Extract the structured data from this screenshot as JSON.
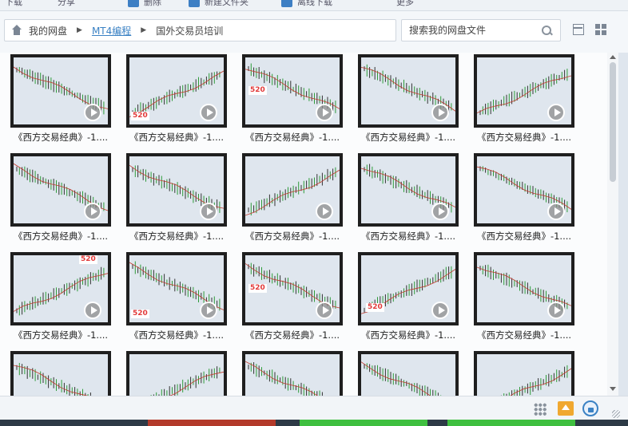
{
  "toolbar": {
    "items": [
      {
        "label": "下载",
        "icon": "download-icon"
      },
      {
        "label": "分享",
        "icon": "share-icon"
      },
      {
        "label": "删除",
        "icon": "delete-icon"
      },
      {
        "label": "新建文件夹",
        "icon": "new-folder-icon"
      },
      {
        "label": "离线下载",
        "icon": "offline-download-icon"
      },
      {
        "label": "更多",
        "icon": "more-icon"
      }
    ]
  },
  "breadcrumb": {
    "home": "我的网盘",
    "folder": "MT4编程",
    "current": "国外交易员培训"
  },
  "search": {
    "placeholder": "搜索我的网盘文件"
  },
  "files": {
    "label": "《西方交易经典》-1....",
    "items": [
      {
        "logo": false
      },
      {
        "logo": true
      },
      {
        "logo": true
      },
      {
        "logo": false
      },
      {
        "logo": false
      },
      {
        "logo": false
      },
      {
        "logo": false
      },
      {
        "logo": false
      },
      {
        "logo": false
      },
      {
        "logo": false
      },
      {
        "logo": true
      },
      {
        "logo": true
      },
      {
        "logo": true
      },
      {
        "logo": true
      },
      {
        "logo": false
      },
      {
        "logo": false
      },
      {
        "logo": false
      },
      {
        "logo": false
      },
      {
        "logo": false
      },
      {
        "logo": false
      }
    ]
  },
  "logo_text": "520",
  "colors": {
    "accent": "#3b82c4",
    "candle_up": "#2e9c3a",
    "candle_down": "#c0392b",
    "upload": "#f0a830"
  }
}
